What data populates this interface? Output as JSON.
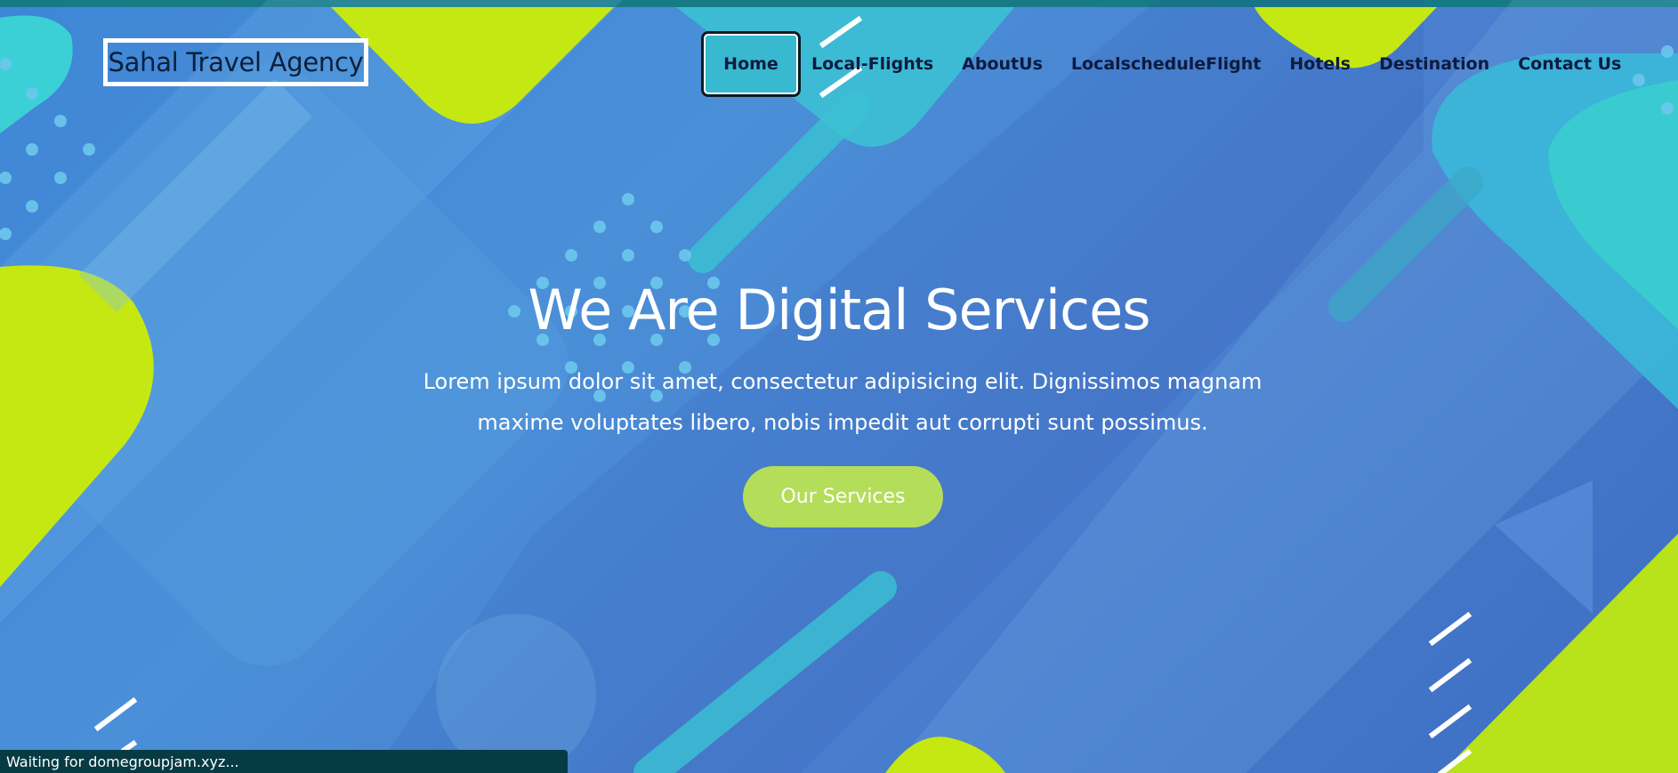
{
  "brand": {
    "name": "Sahal Travel Agency"
  },
  "nav": {
    "items": [
      {
        "label": "Home",
        "active": true
      },
      {
        "label": "Local-Flights",
        "active": false
      },
      {
        "label": "AboutUs",
        "active": false
      },
      {
        "label": "LocalscheduleFlight",
        "active": false
      },
      {
        "label": "Hotels",
        "active": false
      },
      {
        "label": "Destination",
        "active": false
      },
      {
        "label": "Contact Us",
        "active": false
      }
    ]
  },
  "hero": {
    "title": "We Are Digital Services",
    "text": "Lorem ipsum dolor sit amet, consectetur adipisicing elit. Dignissimos magnam maxime voluptates libero, nobis impedit aut corrupti sunt possimus.",
    "button_label": "Our Services"
  },
  "status_bar": {
    "text": "Waiting for domegroupjam.xyz..."
  },
  "colors": {
    "background": "#4a8fd8",
    "accent_lime": "#c5e813",
    "accent_teal": "#38c6d0",
    "button": "#b4dd5a",
    "nav_text": "#0d1b3f"
  }
}
